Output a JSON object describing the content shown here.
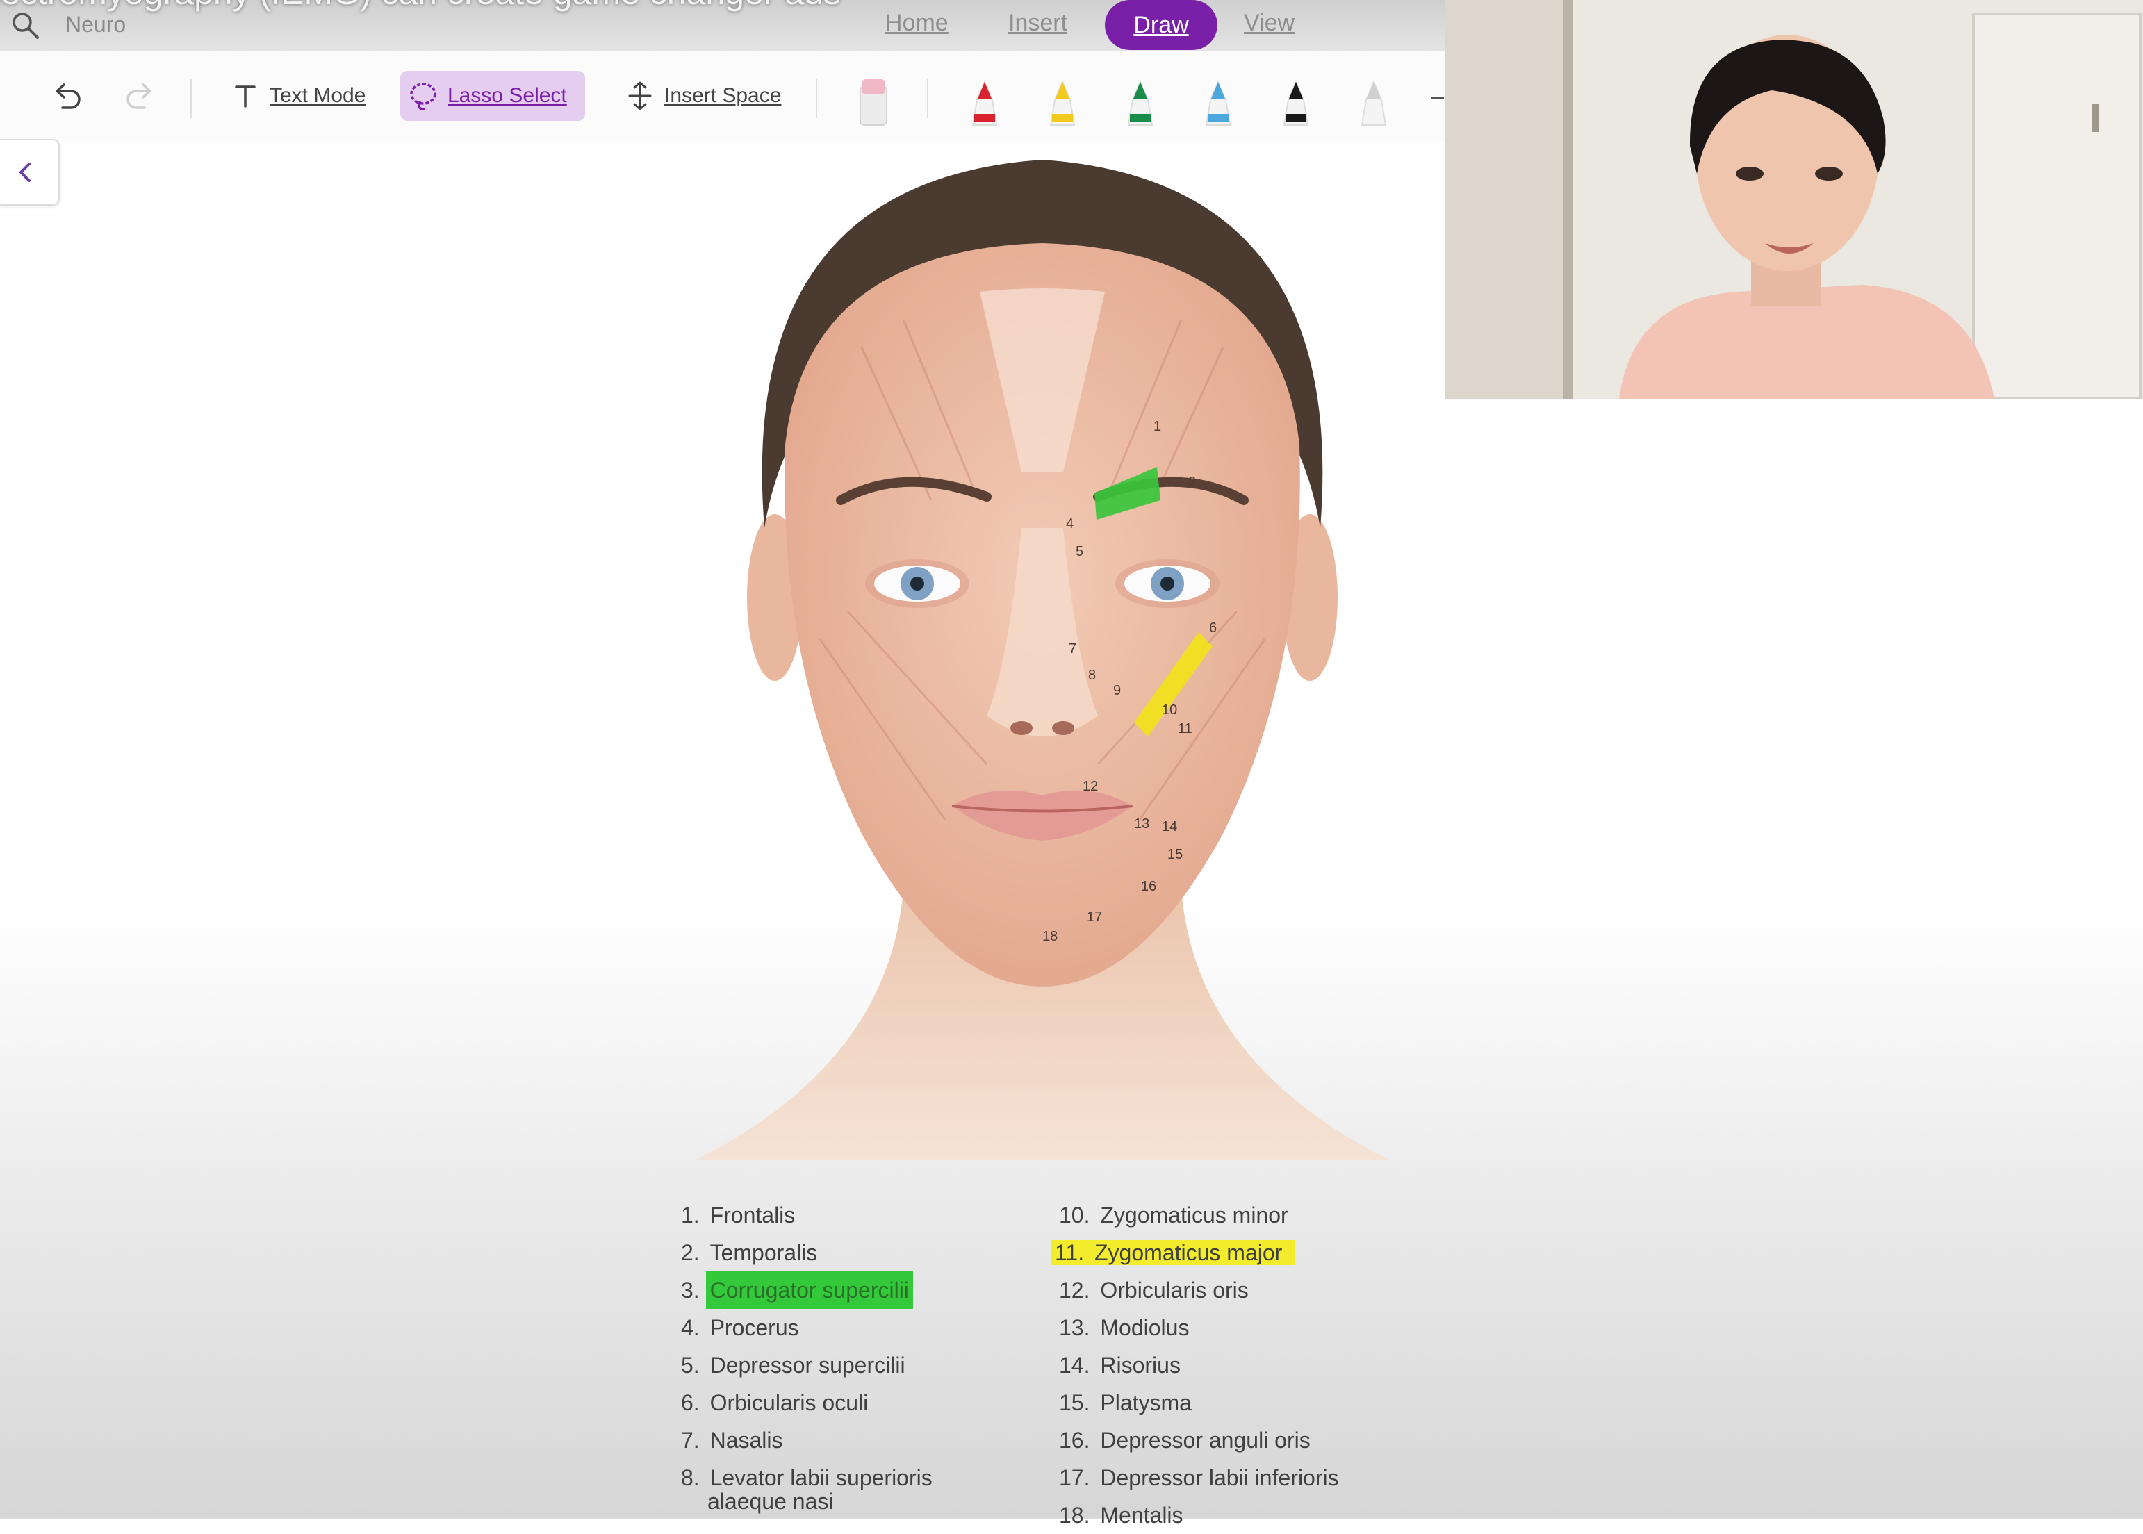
{
  "video": {
    "title": "lectromyography (fEMG) can create game changer ads"
  },
  "search": {
    "label": "Neuro"
  },
  "tabs": {
    "home": "Home",
    "insert": "Insert",
    "draw": "Draw",
    "view": "View"
  },
  "toolbar": {
    "text_mode": "Text Mode",
    "lasso_select": "Lasso Select",
    "insert_space": "Insert Space",
    "pen_colors": [
      "#d8232e",
      "#f2c91c",
      "#1a8c4a",
      "#4da7dc",
      "#1a1a1a",
      "#d0d0d0"
    ]
  },
  "highlights": {
    "green": "#39c63c",
    "yellow": "#f2e318"
  },
  "face_labels": [
    "1",
    "2",
    "4",
    "5",
    "6",
    "7",
    "8",
    "9",
    "10",
    "11",
    "12",
    "13",
    "14",
    "15",
    "16",
    "17",
    "18"
  ],
  "legend": {
    "left": [
      {
        "num": "1.",
        "text": "Frontalis"
      },
      {
        "num": "2.",
        "text": "Temporalis"
      },
      {
        "num": "3.",
        "text": "Corrugator supercilii",
        "highlight": "green"
      },
      {
        "num": "4.",
        "text": "Procerus"
      },
      {
        "num": "5.",
        "text": "Depressor supercilii"
      },
      {
        "num": "6.",
        "text": "Orbicularis oculi"
      },
      {
        "num": "7.",
        "text": "Nasalis"
      },
      {
        "num": "8.",
        "text": "Levator labii superioris",
        "cont": "alaeque nasi"
      }
    ],
    "right": [
      {
        "num": "10.",
        "text": "Zygomaticus minor"
      },
      {
        "num": "11.",
        "text": "Zygomaticus major",
        "highlight": "yellow"
      },
      {
        "num": "12.",
        "text": "Orbicularis oris"
      },
      {
        "num": "13.",
        "text": "Modiolus"
      },
      {
        "num": "14.",
        "text": "Risorius"
      },
      {
        "num": "15.",
        "text": "Platysma"
      },
      {
        "num": "16.",
        "text": "Depressor anguli oris"
      },
      {
        "num": "17.",
        "text": "Depressor labii inferioris"
      },
      {
        "num": "18.",
        "text": "Mentalis"
      }
    ]
  }
}
